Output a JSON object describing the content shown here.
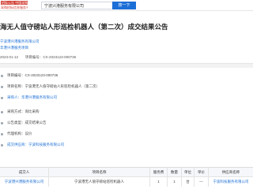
{
  "header": {
    "logo_top": "招标公告 中国采购与招标网",
    "logo_bottom": "采购招标信息服务平台",
    "search_value": "宁波兴港服务有限公司",
    "search_button": "搜一下"
  },
  "notice": {
    "title": "海无人值守磅站人形巡检机器人（第二次）成交结果公告",
    "org_link": "宁波港兴港服务有限公司",
    "source_link": "华港兴港服务项目",
    "date": "2023-01-12",
    "project_no_label": "项目编号：",
    "project_no": "CX-2023123-000736"
  },
  "details": [
    {
      "text": "项目编号：CX-2023123-000736",
      "link": false
    },
    {
      "text": "项目名称：宁波港无人值守磅站人形巡检机器人（第二次）",
      "link": false
    },
    {
      "text": "采购人：华港兴港服务有限公司",
      "link": true
    },
    {
      "text": "采购方式：询比采购",
      "link": false
    },
    {
      "text": "公告类型：成交结果公告",
      "link": false
    },
    {
      "text": "代理机构：议价",
      "link": false
    },
    {
      "text": "成交供应商：宁波科技服务有限公司",
      "link": true
    }
  ],
  "table": {
    "headers": [
      "成交人",
      "项目名称",
      "服务费",
      "数量",
      "单位",
      "单价",
      "供应商名称"
    ],
    "rows": [
      [
        "宁波港兴港服务有限公司",
        "宁波港无人值守磅站巡检机器人",
        "1",
        "1",
        "台",
        "—",
        "宁波科技服务有限公司"
      ]
    ]
  }
}
